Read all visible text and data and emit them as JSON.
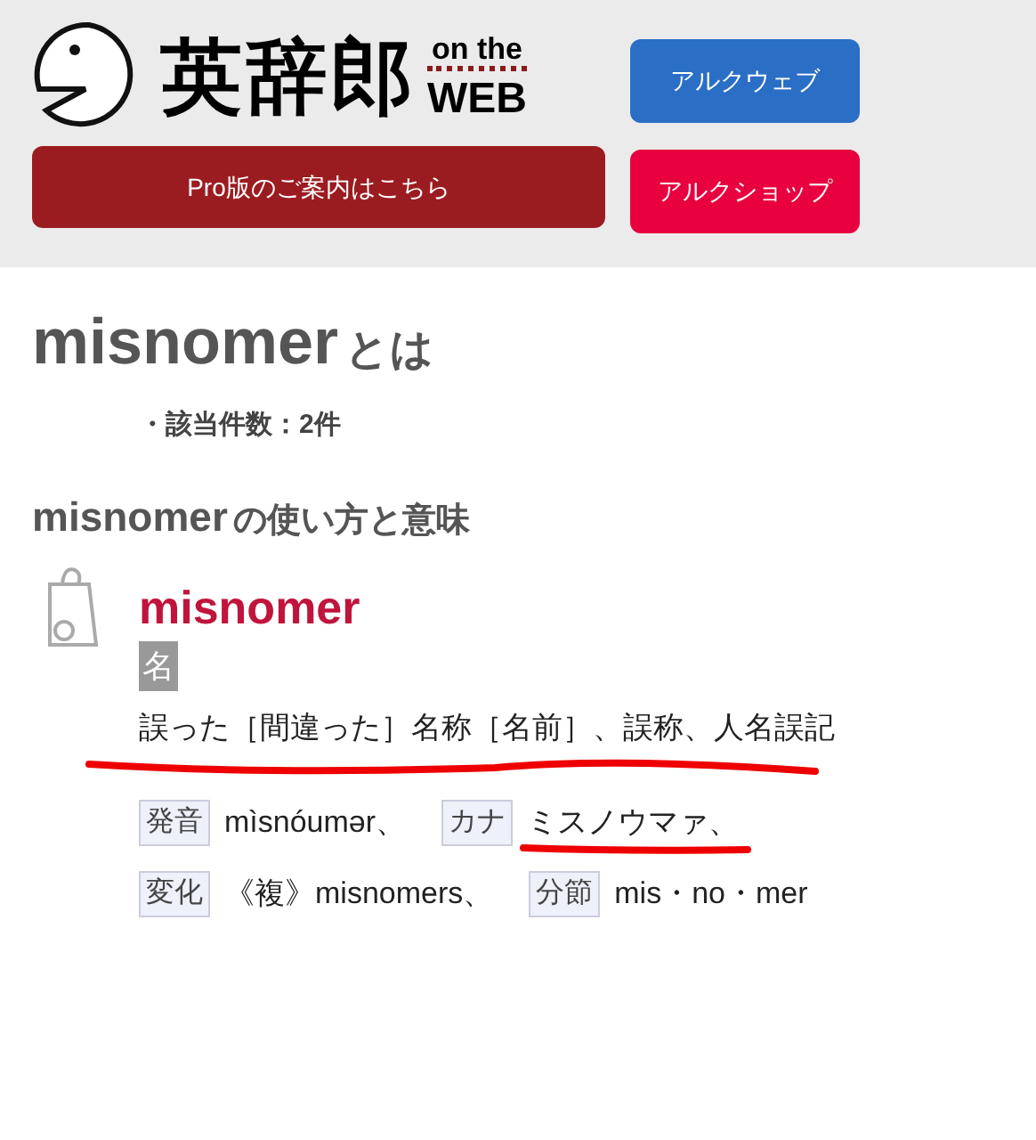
{
  "header": {
    "logo": {
      "title": "英辞郎",
      "sub_top": "on the",
      "sub_bottom": "WEB"
    },
    "buttons": [
      {
        "label": "アルクウェブ",
        "color": "#2a6ec6"
      },
      {
        "label": "Pro版のご案内はこちら",
        "color": "#9b1c20"
      },
      {
        "label": "アルクショップ",
        "color": "#e8003f"
      }
    ]
  },
  "result": {
    "title_word": "misnomer",
    "title_suffix": "とは",
    "count": "・該当件数：2件",
    "heading_word": "misnomer",
    "heading_suffix": "の使い方と意味"
  },
  "entry": {
    "headword": "misnomer",
    "part_of_speech": "名",
    "definition": "誤った［間違った］名称［名前］、誤称、人名誤記",
    "rows": [
      [
        {
          "label": "発音",
          "value": "mìsnóumər、",
          "underlined": false
        },
        {
          "label": "カナ",
          "value": "ミスノウマァ、",
          "underlined": true
        }
      ],
      [
        {
          "label": "変化",
          "value": "《複》misnomers、",
          "underlined": false
        },
        {
          "label": "分節",
          "value": "mis・no・mer",
          "underlined": false
        }
      ]
    ]
  }
}
